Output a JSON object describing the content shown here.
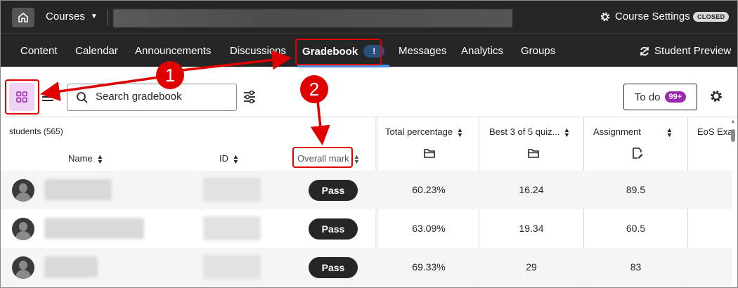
{
  "topbar": {
    "courses_label": "Courses",
    "course_settings_label": "Course Settings",
    "closed_badge": "CLOSED"
  },
  "nav": {
    "items": [
      "Content",
      "Calendar",
      "Announcements",
      "Discussions",
      "Gradebook",
      "Messages",
      "Analytics",
      "Groups"
    ],
    "active": "Gradebook",
    "gradebook_alert": "!",
    "student_preview_label": "Student Preview"
  },
  "toolbar": {
    "search_placeholder": "Search gradebook",
    "todo_label": "To do",
    "todo_badge": "99+"
  },
  "table": {
    "students_label": "students (565)",
    "headers": {
      "name": "Name",
      "id": "ID",
      "overall_mark": "Overall mark",
      "total_percentage": "Total percentage",
      "best_quiz": "Best 3 of 5 quiz...",
      "assignment": "Assignment",
      "eos_exam": "EoS Exa"
    },
    "rows": [
      {
        "overall": "Pass",
        "total_percentage": "60.23%",
        "best_quiz": "16.24",
        "assignment": "89.5"
      },
      {
        "overall": "Pass",
        "total_percentage": "63.09%",
        "best_quiz": "19.34",
        "assignment": "60.5"
      },
      {
        "overall": "Pass",
        "total_percentage": "69.33%",
        "best_quiz": "29",
        "assignment": "83"
      }
    ]
  },
  "annotations": {
    "callout_1": "1",
    "callout_2": "2"
  },
  "colors": {
    "header_bg": "#262626",
    "active_underline": "#4a90e2",
    "annotation_red": "#e00000",
    "todo_badge": "#9c27b0",
    "grid_button_bg": "#f0d4f5"
  },
  "icons": [
    "home-icon",
    "caret-down-icon",
    "gear-icon",
    "refresh-preview-icon",
    "grid-view-icon",
    "list-view-icon",
    "search-icon",
    "filter-icon",
    "folder-icon",
    "document-edit-icon",
    "sort-icon",
    "avatar-icon"
  ]
}
